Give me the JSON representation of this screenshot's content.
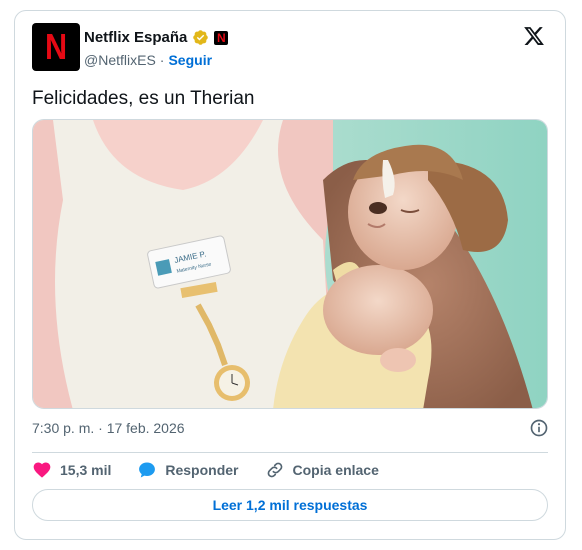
{
  "account": {
    "name": "Netflix España",
    "handle": "@NetflixES",
    "separator": "·",
    "follow_label": "Seguir",
    "avatar_letter": "N"
  },
  "tweet": {
    "text": "Felicidades, es un Therian",
    "timestamp": "7:30 p. m. · 17 feb. 2026"
  },
  "media": {
    "badge_name": "JAMIE P.",
    "badge_title": "Maternity Nurse"
  },
  "actions": {
    "likes_count": "15,3 mil",
    "reply_label": "Responder",
    "copy_link_label": "Copia enlace"
  },
  "read_replies_label": "Leer 1,2 mil respuestas",
  "colors": {
    "accent": "#006fd6",
    "like": "#f91880",
    "netflix_red": "#e50914",
    "muted": "#536471",
    "border": "#cfd9de"
  }
}
